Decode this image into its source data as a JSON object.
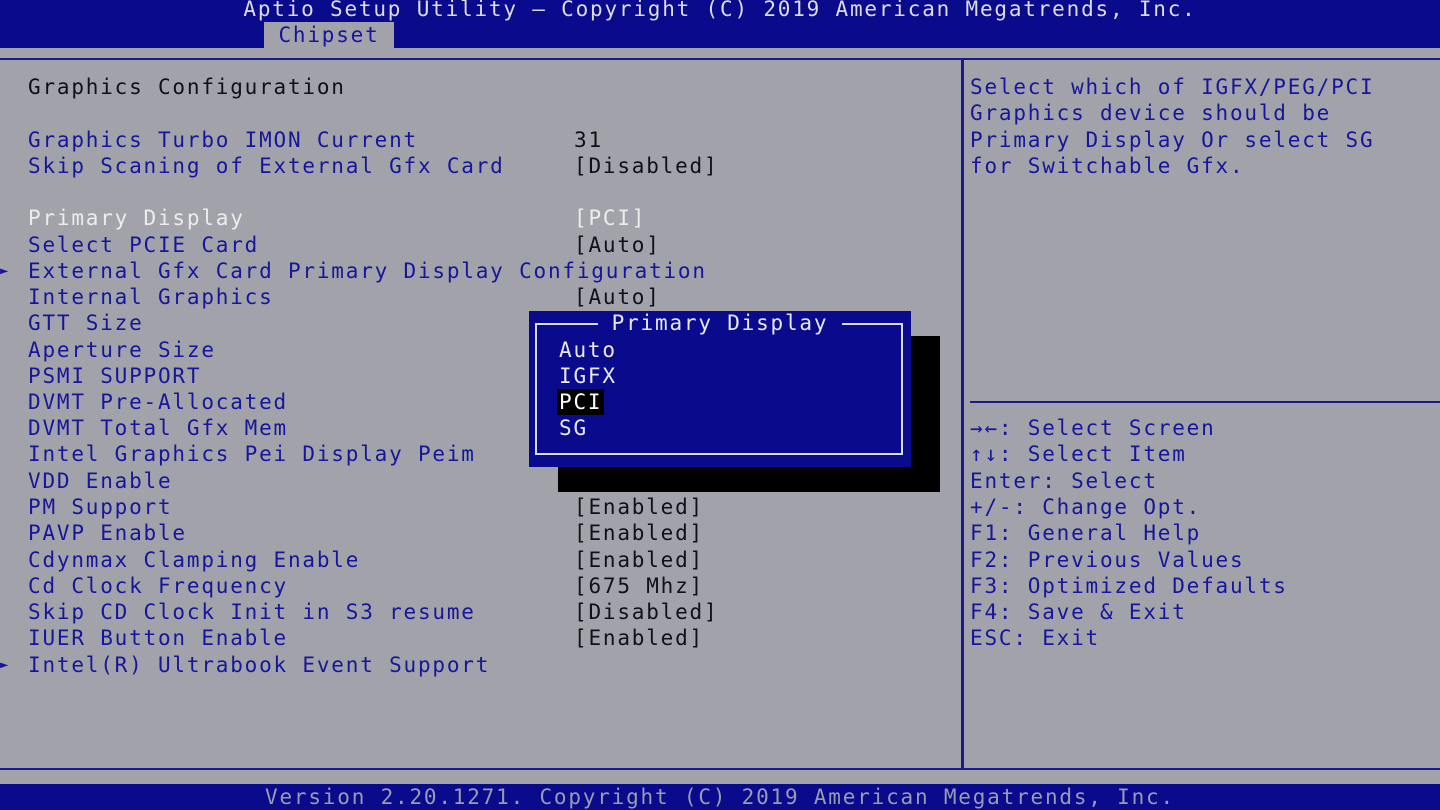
{
  "header": {
    "title": "Aptio Setup Utility – Copyright (C) 2019 American Megatrends, Inc.",
    "active_tab": "Chipset"
  },
  "section_title": "Graphics Configuration",
  "settings": [
    {
      "label": "Graphics Turbo IMON Current",
      "value": "31"
    },
    {
      "label": "Skip Scaning of External Gfx Card",
      "value": "[Disabled]"
    },
    {
      "label": "Primary Display",
      "value": "[PCI]"
    },
    {
      "label": "Select PCIE Card",
      "value": "[Auto]"
    },
    {
      "label": "External Gfx Card Primary Display Configuration",
      "value": ""
    },
    {
      "label": "Internal Graphics",
      "value": "[Auto]"
    },
    {
      "label": "GTT Size",
      "value": ""
    },
    {
      "label": "Aperture Size",
      "value": ""
    },
    {
      "label": "PSMI SUPPORT",
      "value": ""
    },
    {
      "label": "DVMT Pre-Allocated",
      "value": ""
    },
    {
      "label": "DVMT Total Gfx Mem",
      "value": ""
    },
    {
      "label": "Intel Graphics Pei Display Peim",
      "value": ""
    },
    {
      "label": "VDD Enable",
      "value": ""
    },
    {
      "label": "PM Support",
      "value": "[Enabled]"
    },
    {
      "label": "PAVP Enable",
      "value": "[Enabled]"
    },
    {
      "label": "Cdynmax Clamping Enable",
      "value": "[Enabled]"
    },
    {
      "label": "Cd Clock Frequency",
      "value": "[675 Mhz]"
    },
    {
      "label": "Skip CD Clock Init in S3 resume",
      "value": "[Disabled]"
    },
    {
      "label": "IUER Button Enable",
      "value": "[Enabled]"
    },
    {
      "label": "Intel(R) Ultrabook Event Support",
      "value": ""
    }
  ],
  "help_text": [
    "Select which of IGFX/PEG/PCI",
    "Graphics device should be",
    "Primary Display Or select SG",
    "for Switchable Gfx."
  ],
  "key_help": [
    "→←: Select Screen",
    "↑↓: Select Item",
    "Enter: Select",
    "+/-: Change Opt.",
    "F1: General Help",
    "F2: Previous Values",
    "F3: Optimized Defaults",
    "F4: Save & Exit",
    "ESC: Exit"
  ],
  "popup": {
    "title": "Primary Display",
    "options": [
      "Auto",
      "IGFX",
      "PCI",
      "SG"
    ],
    "selected": "PCI"
  },
  "footer": "Version 2.20.1271. Copyright (C) 2019 American Megatrends, Inc.",
  "colors": {
    "background": "#a2a2aa",
    "bar_blue": "#0a0a8c",
    "text_blue": "#16169c",
    "highlight_white": "#ececec"
  }
}
